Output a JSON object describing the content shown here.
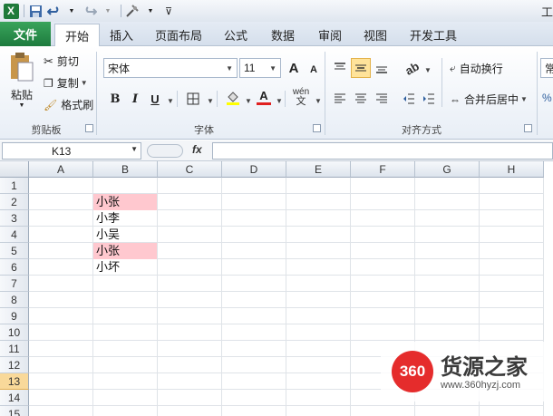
{
  "qat": {
    "title_fragment": "工"
  },
  "tabs": [
    "文件",
    "开始",
    "插入",
    "页面布局",
    "公式",
    "数据",
    "审阅",
    "视图",
    "开发工具"
  ],
  "clipboard": {
    "paste": "粘贴",
    "cut": "剪切",
    "copy": "复制",
    "format_painter": "格式刷",
    "group": "剪贴板"
  },
  "font": {
    "name": "宋体",
    "size": "11",
    "group": "字体",
    "bold": "B",
    "italic": "I",
    "underline": "U",
    "grow": "A",
    "shrink": "A",
    "wen": "wén"
  },
  "align": {
    "wrap": "自动换行",
    "merge": "合并后居中",
    "group": "对齐方式"
  },
  "cutoff": {
    "style": "常"
  },
  "formula": {
    "name_box": "K13",
    "fx": "fx",
    "value": ""
  },
  "columns": [
    "A",
    "B",
    "C",
    "D",
    "E",
    "F",
    "G",
    "H"
  ],
  "rows": [
    "1",
    "2",
    "3",
    "4",
    "5",
    "6",
    "7",
    "8",
    "9",
    "10",
    "11",
    "12",
    "13",
    "14",
    "15"
  ],
  "cells": {
    "b2": "小张",
    "b3": "小李",
    "b4": "小吴",
    "b5": "小张",
    "b6": "小坏"
  },
  "highlight_color": "#ffc8cf",
  "selected_row": "13",
  "watermark": {
    "logo": "360",
    "name": "货源之家",
    "url": "www.360hyzj.com"
  },
  "colors": {
    "file_tab": "#1e7b3e",
    "accent": "#e52c2c"
  }
}
